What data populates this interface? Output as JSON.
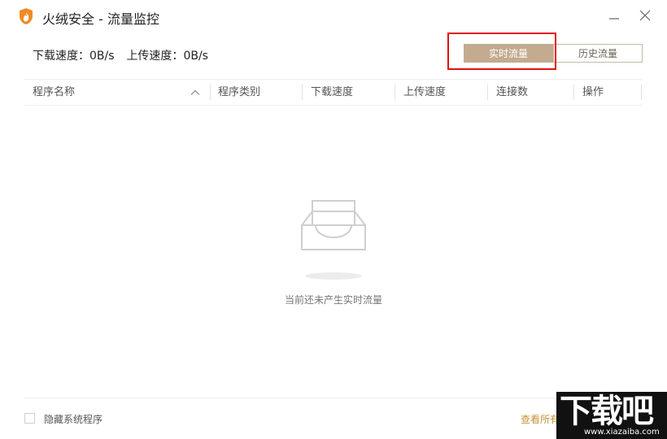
{
  "window": {
    "title": "火绒安全 - 流量监控",
    "accent_color": "#c3ab8f",
    "link_color": "#c8913a",
    "icons": {
      "logo": "huorong-flame-shield-icon",
      "minimize": "minimize-icon",
      "close": "close-icon"
    }
  },
  "speed": {
    "download_label": "下载速度：",
    "download_value": "0B/s",
    "upload_label": "上传速度：",
    "upload_value": "0B/s"
  },
  "tabs": [
    {
      "label": "实时流量",
      "selected": true
    },
    {
      "label": "历史流量",
      "selected": false
    }
  ],
  "table": {
    "columns": [
      "程序名称",
      "程序类别",
      "下载速度",
      "上传速度",
      "连接数",
      "操作"
    ],
    "sort_icon": "chevron-up-icon",
    "rows": []
  },
  "empty_state": {
    "icon": "empty-tray-icon",
    "message": "当前还未产生实时流量"
  },
  "footer": {
    "checkbox_label": "隐藏系统程序",
    "checkbox_checked": false,
    "view_all_label": "查看所有"
  },
  "watermark": {
    "main": "下载吧",
    "sub": "www.xiazaiba.com"
  }
}
